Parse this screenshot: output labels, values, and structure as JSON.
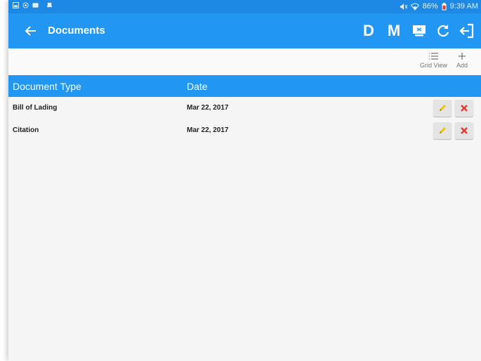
{
  "status_bar": {
    "battery": "86%",
    "time": "9:39 AM"
  },
  "app_bar": {
    "title": "Documents",
    "actions": {
      "d_label": "D",
      "m_label": "M"
    }
  },
  "toolbar": {
    "grid_view_label": "Grid View",
    "add_label": "Add"
  },
  "table": {
    "columns": [
      "Document Type",
      "Date"
    ],
    "rows": [
      {
        "type": "Bill of Lading",
        "date": "Mar 22, 2017"
      },
      {
        "type": "Citation",
        "date": "Mar 22, 2017"
      }
    ]
  },
  "colors": {
    "primary": "#2196f3",
    "status_bar": "#1e88e5",
    "delete": "#e53935",
    "edit": "#f2c100"
  }
}
